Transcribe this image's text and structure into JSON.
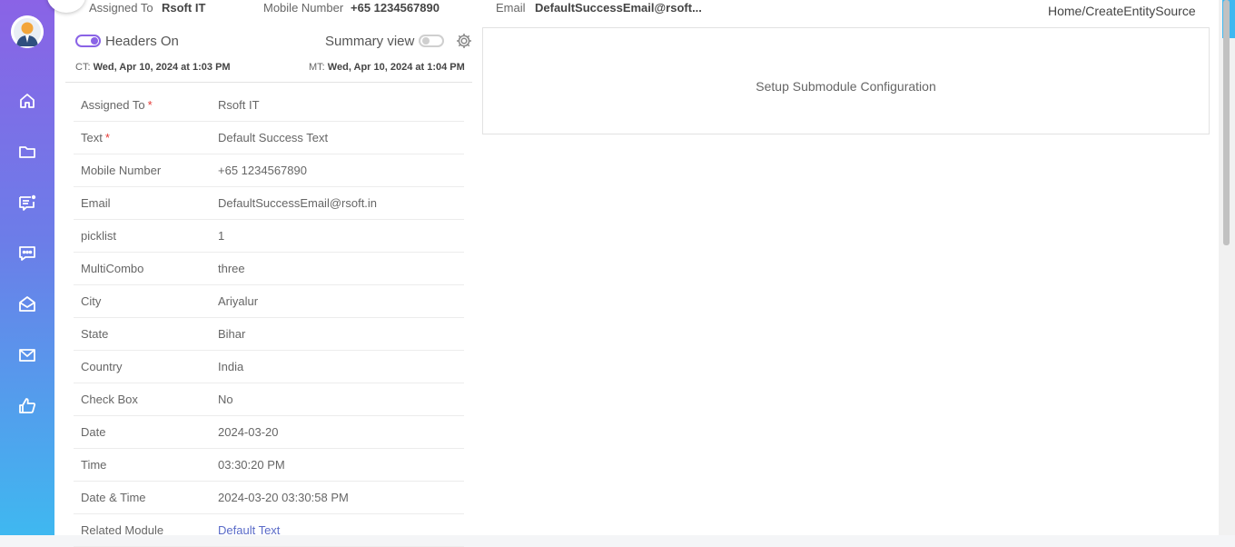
{
  "sidebar": {
    "avatar_icon": "user-avatar-icon",
    "items": [
      {
        "icon": "home-icon"
      },
      {
        "icon": "folder-icon"
      },
      {
        "icon": "chat-notification-icon"
      },
      {
        "icon": "message-icon"
      },
      {
        "icon": "open-mail-icon"
      },
      {
        "icon": "mail-icon"
      },
      {
        "icon": "thumbs-up-icon"
      }
    ]
  },
  "topbar": {
    "assigned_to_label": "Assigned To",
    "assigned_to_value": "Rsoft   IT",
    "mobile_label": "Mobile Number",
    "mobile_value": "+65 1234567890",
    "email_label": "Email",
    "email_value": "DefaultSuccessEmail@rsoft..."
  },
  "breadcrumb": "Home/CreateEntitySource",
  "controls": {
    "headers_label": "Headers On",
    "headers_on": true,
    "summary_label": "Summary view",
    "summary_on": false
  },
  "meta": {
    "ct_label": "CT:",
    "ct_value": "Wed, Apr 10, 2024 at 1:03 PM",
    "mt_label": "MT:",
    "mt_value": "Wed, Apr 10, 2024 at 1:04 PM"
  },
  "fields": [
    {
      "label": "Assigned To",
      "required": "*",
      "value": "Rsoft IT"
    },
    {
      "label": "Text",
      "required": "*",
      "value": "Default Success Text"
    },
    {
      "label": "Mobile Number",
      "required": "",
      "value": "+65   1234567890"
    },
    {
      "label": "Email",
      "required": "",
      "value": "DefaultSuccessEmail@rsoft.in"
    },
    {
      "label": "picklist",
      "required": "",
      "value": "1"
    },
    {
      "label": "MultiCombo",
      "required": "",
      "value": "three"
    },
    {
      "label": "City",
      "required": "",
      "value": "Ariyalur"
    },
    {
      "label": "State",
      "required": "",
      "value": "Bihar"
    },
    {
      "label": "Country",
      "required": "",
      "value": "India"
    },
    {
      "label": "Check Box",
      "required": "",
      "value": "No"
    },
    {
      "label": "Date",
      "required": "",
      "value": "2024-03-20"
    },
    {
      "label": "Time",
      "required": "",
      "value": "03:30:20 PM"
    },
    {
      "label": "Date & Time",
      "required": "",
      "value": "2024-03-20 03:30:58 PM"
    },
    {
      "label": "Related Module",
      "required": "",
      "value": "Default Text"
    }
  ],
  "submodule": {
    "text": "Setup Submodule Configuration"
  },
  "colors": {
    "accent": "#8a63e6",
    "link": "#5a6bc8",
    "required": "#e53935"
  }
}
